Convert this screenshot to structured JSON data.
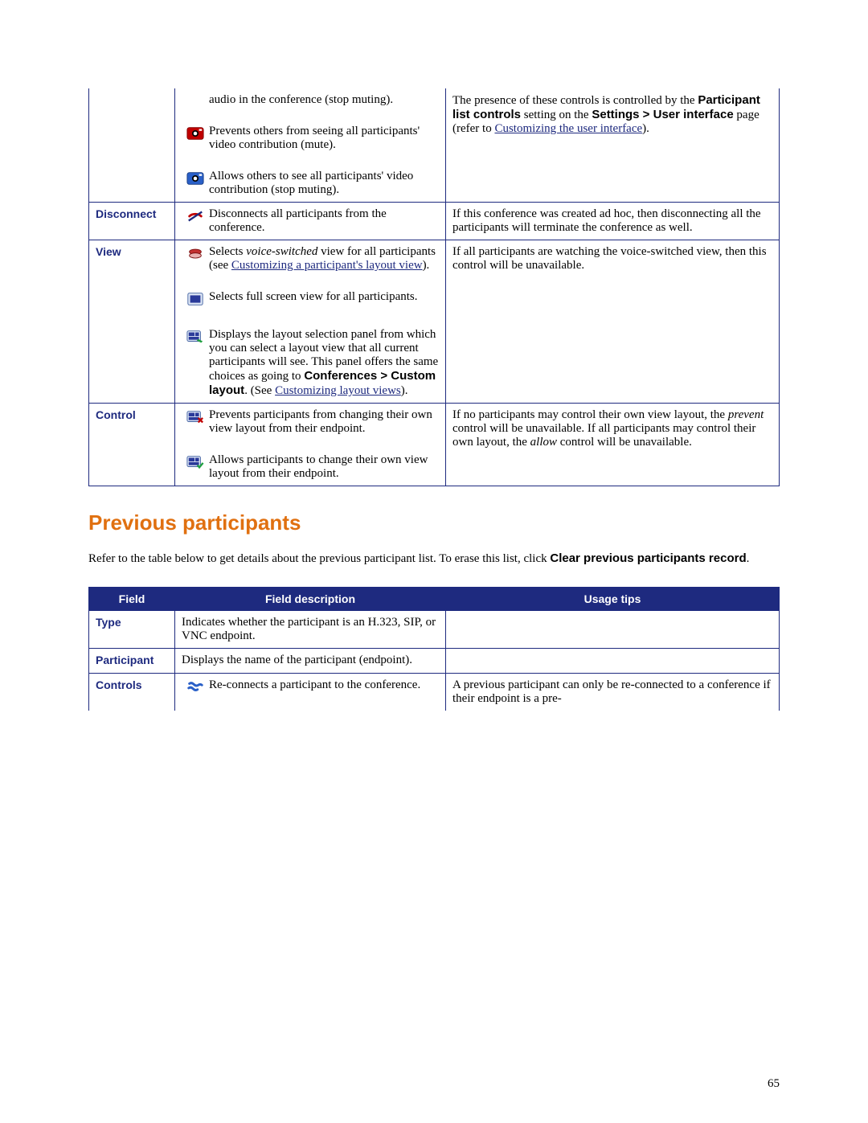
{
  "table1": {
    "row_mute": {
      "sub1_desc": "audio in the conference (stop muting).",
      "sub2_desc": "Prevents others from seeing all participants' video contribution (mute).",
      "sub3_desc": "Allows others to see all participants' video contribution (stop muting).",
      "tips_pre": "The presence of these controls is controlled by the ",
      "tips_bold1": "Participant list controls",
      "tips_mid1": " setting on the ",
      "tips_bold2": "Settings > User interface",
      "tips_mid2": " page (refer to ",
      "tips_link": "Customizing the user interface",
      "tips_post": ")."
    },
    "row_disconnect": {
      "label": "Disconnect",
      "desc": "Disconnects all participants from the conference.",
      "tips": "If this conference was created ad hoc, then disconnecting all the participants will terminate the conference as well."
    },
    "row_view": {
      "label": "View",
      "sub1_pre": "Selects ",
      "sub1_italic": "voice-switched",
      "sub1_mid": " view for all participants (see ",
      "sub1_link": "Customizing a participant's layout view",
      "sub1_post": ").",
      "sub2_desc": "Selects full screen view for all participants.",
      "sub3_pre": "Displays the layout selection panel from which you can select a layout view that all current participants will see. This panel offers the same choices as going to ",
      "sub3_bold": "Conferences > Custom layout",
      "sub3_mid": ". (See ",
      "sub3_link": "Customizing layout views",
      "sub3_post": ").",
      "tips": "If all participants are watching the voice-switched view, then this control will be unavailable."
    },
    "row_control": {
      "label": "Control",
      "sub1_desc": "Prevents participants from changing their own view layout from their endpoint.",
      "sub2_desc": "Allows participants to change their own view layout from their endpoint.",
      "tips_pre": "If no participants may control their own view layout, the ",
      "tips_italic1": "prevent",
      "tips_mid1": " control will be unavailable. If all participants may control their own layout, the ",
      "tips_italic2": "allow",
      "tips_post": " control will be unavailable."
    }
  },
  "section_heading": "Previous participants",
  "intro_pre": "Refer to the table below to get details about the previous participant list. To erase this list, click ",
  "intro_bold": "Clear previous participants record",
  "intro_post": ".",
  "table2": {
    "head_field": "Field",
    "head_desc": "Field description",
    "head_tips": "Usage tips",
    "row_type": {
      "label": "Type",
      "desc": "Indicates whether the participant is an H.323, SIP, or VNC endpoint."
    },
    "row_participant": {
      "label": "Participant",
      "desc": "Displays the name of the participant (endpoint)."
    },
    "row_controls": {
      "label": "Controls",
      "desc": "Re-connects a participant to the conference.",
      "tips": "A previous participant can only be re-connected to a conference if their endpoint is a pre-"
    }
  },
  "page_number": "65"
}
